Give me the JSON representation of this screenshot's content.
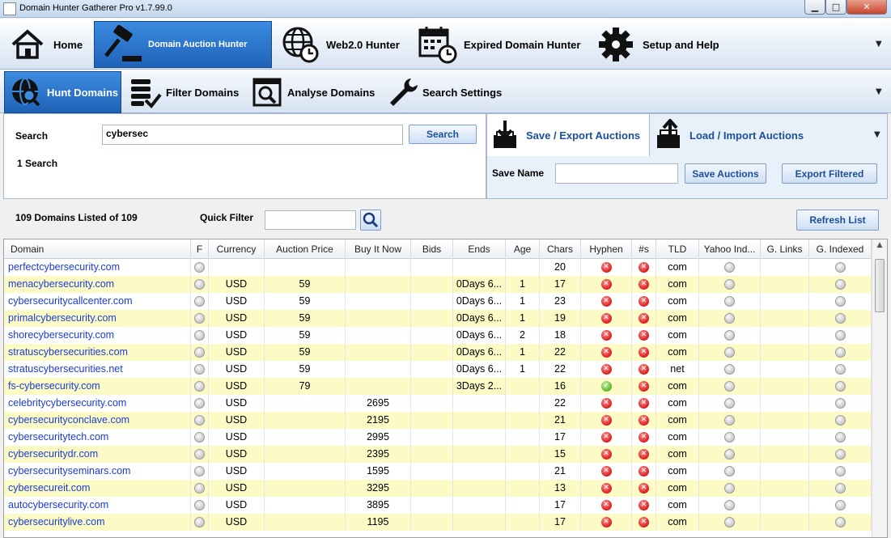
{
  "window": {
    "title": "Domain Hunter Gatherer Pro v1.7.99.0",
    "minimize": "▁",
    "maximize": "□",
    "close": "✕"
  },
  "main_tabs": [
    {
      "label": "Home",
      "icon": "home-icon"
    },
    {
      "label": "Domain Auction Hunter",
      "icon": "gavel-icon"
    },
    {
      "label": "Web2.0 Hunter",
      "icon": "globe-clock-icon"
    },
    {
      "label": "Expired Domain Hunter",
      "icon": "calendar-clock-icon"
    },
    {
      "label": "Setup and Help",
      "icon": "gear-icon"
    }
  ],
  "sub_tabs": [
    {
      "label": "Hunt Domains",
      "icon": "globe-search-icon"
    },
    {
      "label": "Filter Domains",
      "icon": "list-check-icon"
    },
    {
      "label": "Analyse Domains",
      "icon": "window-search-icon"
    },
    {
      "label": "Search Settings",
      "icon": "wrench-icon"
    }
  ],
  "search": {
    "label": "Search",
    "value": "cybersec",
    "button": "Search",
    "count_text": "1 Search"
  },
  "export": {
    "tab_save": "Save / Export Auctions",
    "tab_load": "Load / Import Auctions",
    "save_name_label": "Save Name",
    "save_name_value": "",
    "save_button": "Save Auctions",
    "export_button": "Export Filtered"
  },
  "list": {
    "count_text": "109 Domains Listed of 109",
    "quick_filter_label": "Quick Filter",
    "quick_filter_value": "",
    "refresh_button": "Refresh List"
  },
  "columns": [
    "Domain",
    "F",
    "Currency",
    "Auction Price",
    "Buy It Now",
    "Bids",
    "Ends",
    "Age",
    "Chars",
    "Hyphen",
    "#s",
    "TLD",
    "Yahoo Ind...",
    "G. Links",
    "G. Indexed"
  ],
  "rows": [
    {
      "domain": "perfectcybersecurity.com",
      "currency": "",
      "price": "",
      "bin": "",
      "bids": "",
      "ends": "",
      "age": "",
      "chars": "20",
      "hyphen": "no",
      "nums": "no",
      "tld": "com"
    },
    {
      "domain": "menacybersecurity.com",
      "currency": "USD",
      "price": "59",
      "bin": "",
      "bids": "",
      "ends": "0Days 6...",
      "age": "1",
      "chars": "17",
      "hyphen": "no",
      "nums": "no",
      "tld": "com"
    },
    {
      "domain": "cybersecuritycallcenter.com",
      "currency": "USD",
      "price": "59",
      "bin": "",
      "bids": "",
      "ends": "0Days 6...",
      "age": "1",
      "chars": "23",
      "hyphen": "no",
      "nums": "no",
      "tld": "com"
    },
    {
      "domain": "primalcybersecurity.com",
      "currency": "USD",
      "price": "59",
      "bin": "",
      "bids": "",
      "ends": "0Days 6...",
      "age": "1",
      "chars": "19",
      "hyphen": "no",
      "nums": "no",
      "tld": "com"
    },
    {
      "domain": "shorecybersecurity.com",
      "currency": "USD",
      "price": "59",
      "bin": "",
      "bids": "",
      "ends": "0Days 6...",
      "age": "2",
      "chars": "18",
      "hyphen": "no",
      "nums": "no",
      "tld": "com"
    },
    {
      "domain": "stratuscybersecurities.com",
      "currency": "USD",
      "price": "59",
      "bin": "",
      "bids": "",
      "ends": "0Days 6...",
      "age": "1",
      "chars": "22",
      "hyphen": "no",
      "nums": "no",
      "tld": "com"
    },
    {
      "domain": "stratuscybersecurities.net",
      "currency": "USD",
      "price": "59",
      "bin": "",
      "bids": "",
      "ends": "0Days 6...",
      "age": "1",
      "chars": "22",
      "hyphen": "no",
      "nums": "no",
      "tld": "net"
    },
    {
      "domain": "fs-cybersecurity.com",
      "currency": "USD",
      "price": "79",
      "bin": "",
      "bids": "",
      "ends": "3Days 2...",
      "age": "",
      "chars": "16",
      "hyphen": "yes",
      "nums": "no",
      "tld": "com"
    },
    {
      "domain": "celebritycybersecurity.com",
      "currency": "USD",
      "price": "",
      "bin": "2695",
      "bids": "",
      "ends": "",
      "age": "",
      "chars": "22",
      "hyphen": "no",
      "nums": "no",
      "tld": "com"
    },
    {
      "domain": "cybersecurityconclave.com",
      "currency": "USD",
      "price": "",
      "bin": "2195",
      "bids": "",
      "ends": "",
      "age": "",
      "chars": "21",
      "hyphen": "no",
      "nums": "no",
      "tld": "com"
    },
    {
      "domain": "cybersecuritytech.com",
      "currency": "USD",
      "price": "",
      "bin": "2995",
      "bids": "",
      "ends": "",
      "age": "",
      "chars": "17",
      "hyphen": "no",
      "nums": "no",
      "tld": "com"
    },
    {
      "domain": "cybersecuritydr.com",
      "currency": "USD",
      "price": "",
      "bin": "2395",
      "bids": "",
      "ends": "",
      "age": "",
      "chars": "15",
      "hyphen": "no",
      "nums": "no",
      "tld": "com"
    },
    {
      "domain": "cybersecurityseminars.com",
      "currency": "USD",
      "price": "",
      "bin": "1595",
      "bids": "",
      "ends": "",
      "age": "",
      "chars": "21",
      "hyphen": "no",
      "nums": "no",
      "tld": "com"
    },
    {
      "domain": "cybersecureit.com",
      "currency": "USD",
      "price": "",
      "bin": "3295",
      "bids": "",
      "ends": "",
      "age": "",
      "chars": "13",
      "hyphen": "no",
      "nums": "no",
      "tld": "com"
    },
    {
      "domain": "autocybersecurity.com",
      "currency": "USD",
      "price": "",
      "bin": "3895",
      "bids": "",
      "ends": "",
      "age": "",
      "chars": "17",
      "hyphen": "no",
      "nums": "no",
      "tld": "com"
    },
    {
      "domain": "cybersecuritylive.com",
      "currency": "USD",
      "price": "",
      "bin": "1195",
      "bids": "",
      "ends": "",
      "age": "",
      "chars": "17",
      "hyphen": "no",
      "nums": "no",
      "tld": "com"
    }
  ]
}
